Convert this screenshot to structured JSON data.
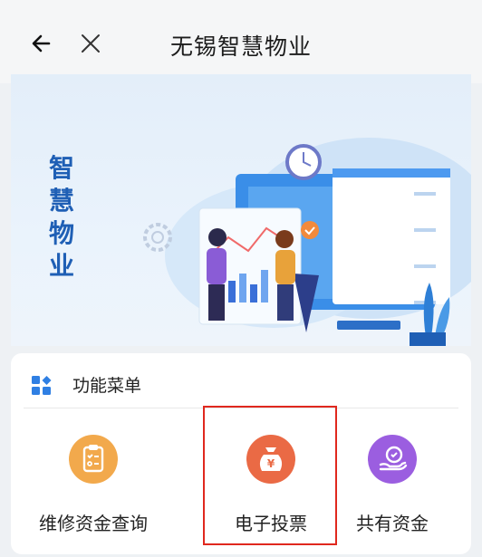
{
  "header": {
    "back_icon": "arrow-left-icon",
    "close_icon": "close-icon",
    "title": "无锡智慧物业"
  },
  "banner": {
    "vertical_text": [
      "智",
      "慧",
      "物",
      "业"
    ]
  },
  "menu": {
    "icon": "grid-icon",
    "title": "功能菜单",
    "items": [
      {
        "label": "维修资金查询",
        "icon": "clipboard-icon",
        "color": "#f2a94c"
      },
      {
        "label": "电子投票",
        "icon": "money-bag-icon",
        "color": "#ea6a45",
        "selected": true
      },
      {
        "label": "共有资金",
        "icon": "hand-coin-icon",
        "color": "#9b5ee0"
      }
    ]
  },
  "colors": {
    "accent_blue": "#2f7fe3",
    "highlight_border": "#e0281e"
  }
}
